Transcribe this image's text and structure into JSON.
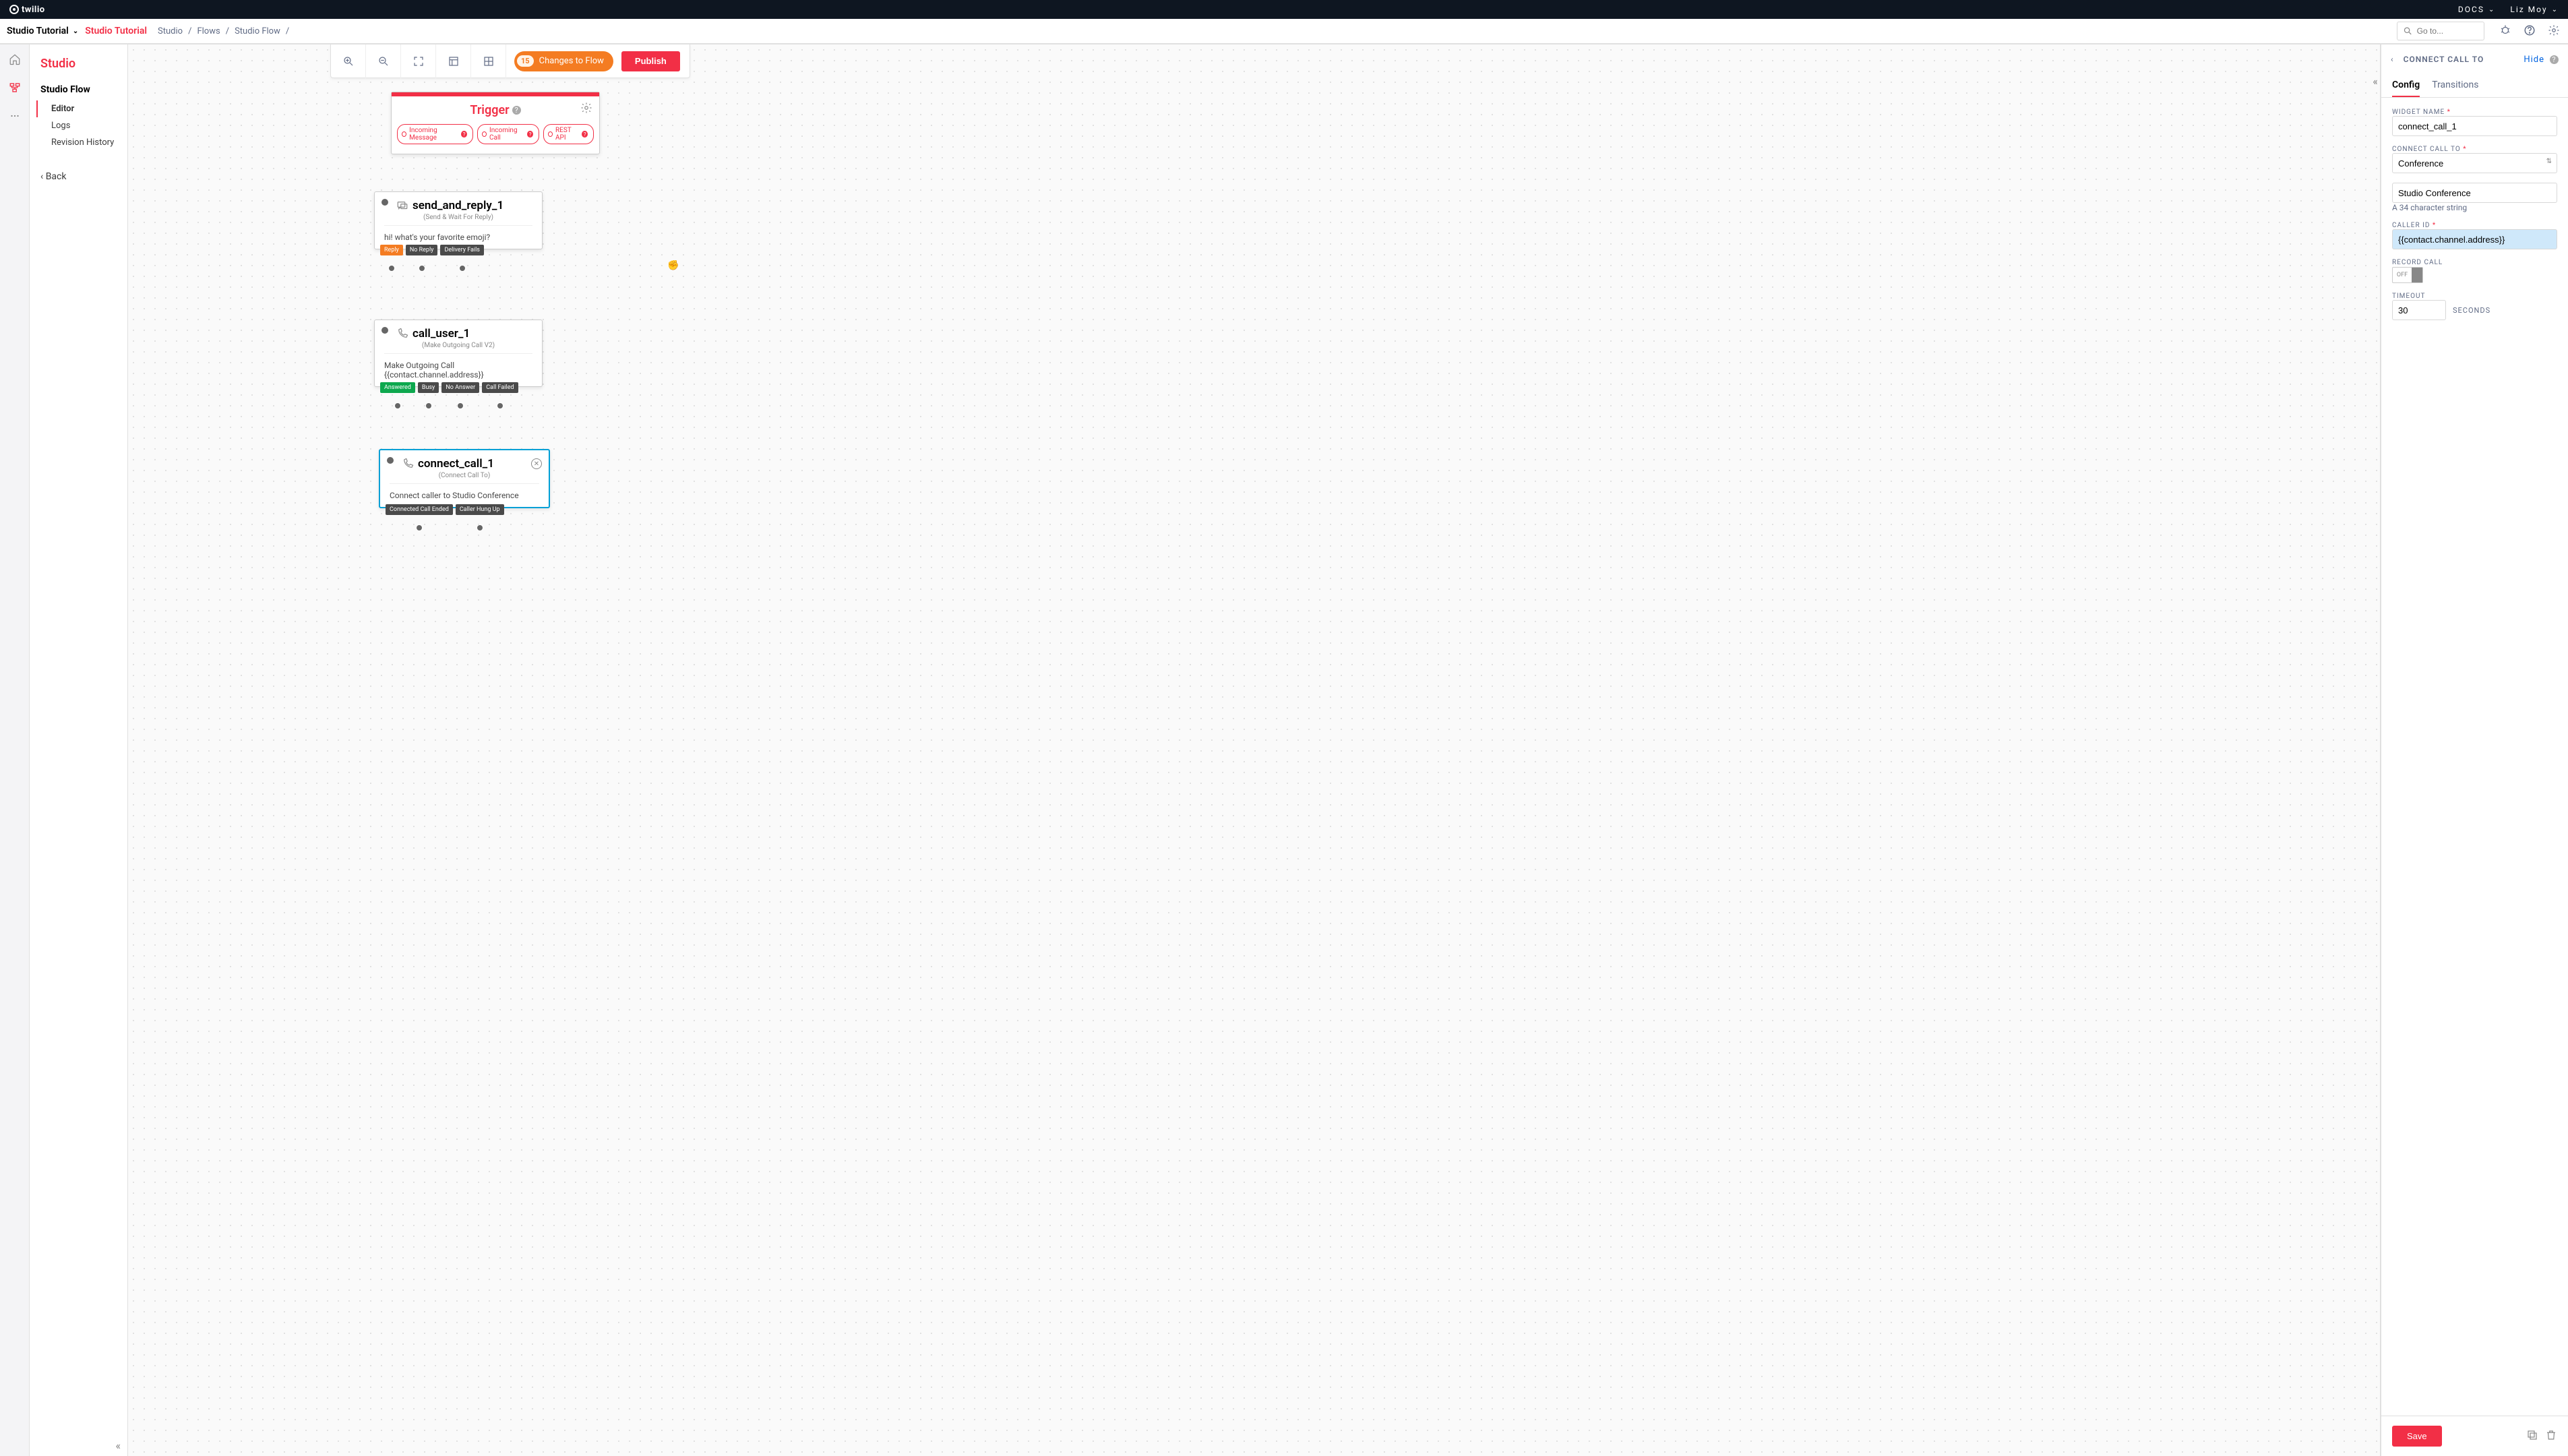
{
  "topbar": {
    "brand": "twilio",
    "docs": "DOCS",
    "user": "Liz Moy"
  },
  "secbar": {
    "project": "Studio Tutorial",
    "project_active": "Studio Tutorial",
    "crumbs": [
      "Studio",
      "Flows",
      "Studio Flow"
    ],
    "search_placeholder": "Go to..."
  },
  "sidebar": {
    "title": "Studio",
    "section": "Studio Flow",
    "items": [
      "Editor",
      "Logs",
      "Revision History"
    ],
    "back": "Back"
  },
  "toolbar": {
    "changes_count": "15",
    "changes_text": "Changes to Flow",
    "publish": "Publish"
  },
  "trigger": {
    "title": "Trigger",
    "pills": [
      "Incoming Message",
      "Incoming Call",
      "REST API"
    ]
  },
  "node1": {
    "name": "send_and_reply_1",
    "type": "(Send & Wait For Reply)",
    "body": "hi! what's your favorite emoji?",
    "outs": [
      "Reply",
      "No Reply",
      "Delivery Fails"
    ]
  },
  "node2": {
    "name": "call_user_1",
    "type": "(Make Outgoing Call V2)",
    "body1": "Make Outgoing Call",
    "body2": "{{contact.channel.address}}",
    "outs": [
      "Answered",
      "Busy",
      "No Answer",
      "Call Failed"
    ]
  },
  "node3": {
    "name": "connect_call_1",
    "type": "(Connect Call To)",
    "body": "Connect caller to Studio Conference",
    "outs": [
      "Connected Call Ended",
      "Caller Hung Up"
    ]
  },
  "panel": {
    "title": "CONNECT CALL TO",
    "hide": "Hide",
    "tabs": [
      "Config",
      "Transitions"
    ],
    "widget_name_label": "WIDGET NAME",
    "widget_name": "connect_call_1",
    "connect_label": "CONNECT CALL TO",
    "connect_value": "Conference",
    "conf_name": "Studio Conference",
    "conf_hint": "A 34 character string",
    "caller_id_label": "CALLER ID",
    "caller_id": "{{contact.channel.address}}",
    "record_label": "RECORD CALL",
    "record_state": "OFF",
    "timeout_label": "TIMEOUT",
    "timeout": "30",
    "seconds": "SECONDS",
    "save": "Save"
  }
}
